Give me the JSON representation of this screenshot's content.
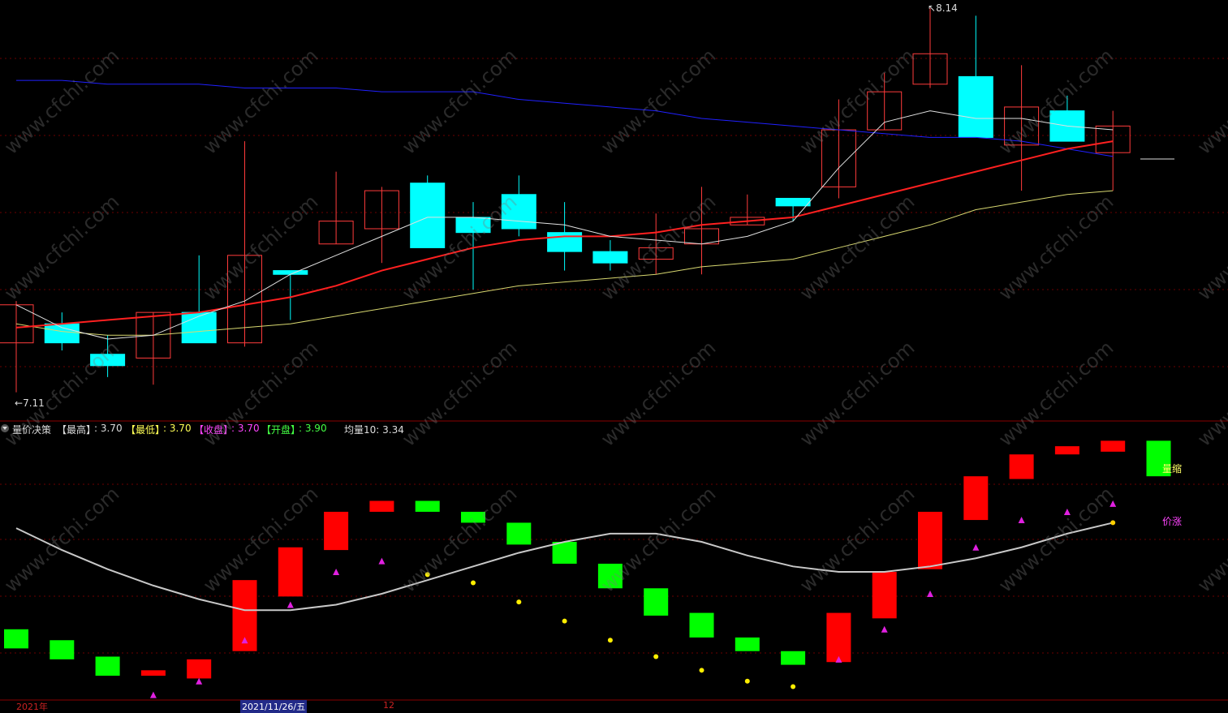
{
  "chart_data": {
    "type": "candlestick",
    "price_panel": {
      "max_label": "8.14",
      "min_label": "7.11",
      "ohlc": [
        [
          7.26,
          7.36,
          7.13,
          7.37
        ],
        [
          7.31,
          7.26,
          7.24,
          7.34
        ],
        [
          7.23,
          7.2,
          7.17,
          7.28
        ],
        [
          7.22,
          7.34,
          7.15,
          7.34
        ],
        [
          7.34,
          7.26,
          7.26,
          7.49
        ],
        [
          7.26,
          7.49,
          7.25,
          7.79
        ],
        [
          7.45,
          7.44,
          7.32,
          7.45
        ],
        [
          7.52,
          7.58,
          7.52,
          7.71
        ],
        [
          7.56,
          7.66,
          7.47,
          7.67
        ],
        [
          7.68,
          7.51,
          7.51,
          7.7
        ],
        [
          7.59,
          7.55,
          7.4,
          7.63
        ],
        [
          7.65,
          7.56,
          7.54,
          7.7
        ],
        [
          7.55,
          7.5,
          7.45,
          7.63
        ],
        [
          7.5,
          7.47,
          7.45,
          7.53
        ],
        [
          7.48,
          7.51,
          7.44,
          7.6
        ],
        [
          7.52,
          7.56,
          7.44,
          7.67
        ],
        [
          7.57,
          7.59,
          7.57,
          7.65
        ],
        [
          7.64,
          7.62,
          7.58,
          7.64
        ],
        [
          7.67,
          7.82,
          7.64,
          7.9
        ],
        [
          7.82,
          7.92,
          7.82,
          7.97
        ],
        [
          7.94,
          8.02,
          7.93,
          8.14
        ],
        [
          7.96,
          7.8,
          7.8,
          8.12
        ],
        [
          7.78,
          7.88,
          7.66,
          7.99
        ],
        [
          7.87,
          7.79,
          7.79,
          7.91
        ],
        [
          7.76,
          7.83,
          7.66,
          7.87
        ]
      ],
      "ma_white": [
        7.36,
        7.3,
        7.27,
        7.28,
        7.33,
        7.37,
        7.44,
        7.49,
        7.54,
        7.59,
        7.59,
        7.58,
        7.57,
        7.54,
        7.53,
        7.52,
        7.54,
        7.58,
        7.72,
        7.84,
        7.87,
        7.85,
        7.85,
        7.83,
        7.82
      ],
      "ma_red": [
        7.3,
        7.31,
        7.32,
        7.33,
        7.34,
        7.36,
        7.38,
        7.41,
        7.45,
        7.48,
        7.51,
        7.53,
        7.54,
        7.54,
        7.55,
        7.57,
        7.58,
        7.59,
        7.62,
        7.65,
        7.68,
        7.71,
        7.74,
        7.77,
        7.79
      ],
      "ma_yellow": [
        7.31,
        7.29,
        7.28,
        7.28,
        7.29,
        7.3,
        7.31,
        7.33,
        7.35,
        7.37,
        7.39,
        7.41,
        7.42,
        7.43,
        7.44,
        7.46,
        7.47,
        7.48,
        7.51,
        7.54,
        7.57,
        7.61,
        7.63,
        7.65,
        7.66
      ],
      "ma_blue": [
        7.95,
        7.95,
        7.94,
        7.94,
        7.94,
        7.93,
        7.93,
        7.93,
        7.92,
        7.92,
        7.92,
        7.9,
        7.89,
        7.88,
        7.87,
        7.85,
        7.84,
        7.83,
        7.82,
        7.81,
        7.8,
        7.8,
        7.79,
        7.77,
        7.75
      ]
    },
    "indicator_panel": {
      "bars": [
        {
          "top": 0.45,
          "bottom": 0.38,
          "color": "green"
        },
        {
          "top": 0.41,
          "bottom": 0.34,
          "color": "green"
        },
        {
          "top": 0.35,
          "bottom": 0.28,
          "color": "green"
        },
        {
          "top": 0.3,
          "bottom": 0.28,
          "color": "red"
        },
        {
          "top": 0.34,
          "bottom": 0.27,
          "color": "red"
        },
        {
          "top": 0.63,
          "bottom": 0.37,
          "color": "red"
        },
        {
          "top": 0.75,
          "bottom": 0.57,
          "color": "red"
        },
        {
          "top": 0.88,
          "bottom": 0.74,
          "color": "red"
        },
        {
          "top": 0.92,
          "bottom": 0.88,
          "color": "red"
        },
        {
          "top": 0.92,
          "bottom": 0.88,
          "color": "green"
        },
        {
          "top": 0.88,
          "bottom": 0.84,
          "color": "green"
        },
        {
          "top": 0.84,
          "bottom": 0.76,
          "color": "green"
        },
        {
          "top": 0.77,
          "bottom": 0.69,
          "color": "green"
        },
        {
          "top": 0.69,
          "bottom": 0.6,
          "color": "green"
        },
        {
          "top": 0.6,
          "bottom": 0.5,
          "color": "green"
        },
        {
          "top": 0.51,
          "bottom": 0.42,
          "color": "green"
        },
        {
          "top": 0.42,
          "bottom": 0.37,
          "color": "green"
        },
        {
          "top": 0.37,
          "bottom": 0.32,
          "color": "green"
        },
        {
          "top": 0.51,
          "bottom": 0.33,
          "color": "red"
        },
        {
          "top": 0.66,
          "bottom": 0.49,
          "color": "red"
        },
        {
          "top": 0.88,
          "bottom": 0.67,
          "color": "red"
        },
        {
          "top": 1.01,
          "bottom": 0.85,
          "color": "red"
        },
        {
          "top": 1.09,
          "bottom": 1.0,
          "color": "red"
        },
        {
          "top": 1.12,
          "bottom": 1.09,
          "color": "red"
        },
        {
          "top": 1.14,
          "bottom": 1.1,
          "color": "red"
        },
        {
          "top": 1.14,
          "bottom": 1.01,
          "color": "green"
        }
      ],
      "avg_line": [
        0.82,
        0.74,
        0.67,
        0.61,
        0.56,
        0.52,
        0.52,
        0.54,
        0.58,
        0.63,
        0.68,
        0.73,
        0.77,
        0.8,
        0.8,
        0.77,
        0.72,
        0.68,
        0.66,
        0.66,
        0.68,
        0.71,
        0.75,
        0.8,
        0.84
      ],
      "markers": [
        {
          "x": 3,
          "y": 0.21,
          "type": "triangle"
        },
        {
          "x": 4,
          "y": 0.26,
          "type": "triangle"
        },
        {
          "x": 5,
          "y": 0.41,
          "type": "triangle"
        },
        {
          "x": 6,
          "y": 0.54,
          "type": "triangle"
        },
        {
          "x": 7,
          "y": 0.66,
          "type": "triangle"
        },
        {
          "x": 8,
          "y": 0.7,
          "type": "triangle"
        },
        {
          "x": 9,
          "y": 0.65,
          "type": "dot"
        },
        {
          "x": 10,
          "y": 0.62,
          "type": "dot"
        },
        {
          "x": 11,
          "y": 0.55,
          "type": "dot"
        },
        {
          "x": 12,
          "y": 0.48,
          "type": "dot"
        },
        {
          "x": 13,
          "y": 0.41,
          "type": "dot"
        },
        {
          "x": 14,
          "y": 0.35,
          "type": "dot"
        },
        {
          "x": 15,
          "y": 0.3,
          "type": "dot"
        },
        {
          "x": 16,
          "y": 0.26,
          "type": "dot"
        },
        {
          "x": 17,
          "y": 0.24,
          "type": "dot"
        },
        {
          "x": 18,
          "y": 0.34,
          "type": "triangle"
        },
        {
          "x": 19,
          "y": 0.45,
          "type": "triangle"
        },
        {
          "x": 20,
          "y": 0.58,
          "type": "triangle"
        },
        {
          "x": 21,
          "y": 0.75,
          "type": "triangle"
        },
        {
          "x": 22,
          "y": 0.85,
          "type": "triangle"
        },
        {
          "x": 23,
          "y": 0.88,
          "type": "triangle"
        },
        {
          "x": 24,
          "y": 0.91,
          "type": "triangle"
        }
      ]
    }
  },
  "indicator_header": {
    "name": "量价决策",
    "high_label": "【最高】",
    "high_value": ": 3.70",
    "low_label": "【最低】",
    "low_value": ": 3.70",
    "close_label": "【收盘】",
    "close_value": ": 3.70",
    "open_label": "【开盘】",
    "open_value": ": 3.90",
    "avg_label": "均量10: 3.34"
  },
  "signals": {
    "volume_label": "量缩",
    "price_label": "价涨"
  },
  "date_axis": {
    "year": "2021年",
    "date": "2021/11/26/五",
    "month": "12"
  },
  "watermark": "www.cfchi.com",
  "colors": {
    "up": "#ff3b3b",
    "down": "#00ffff",
    "ind_red": "#ff0000",
    "ind_green": "#00ff00",
    "ma_white": "#e0e0e0",
    "ma_red": "#ff2020",
    "ma_yellow": "#d8d870",
    "ma_blue": "#2020ff",
    "grid": "#6b0000"
  }
}
